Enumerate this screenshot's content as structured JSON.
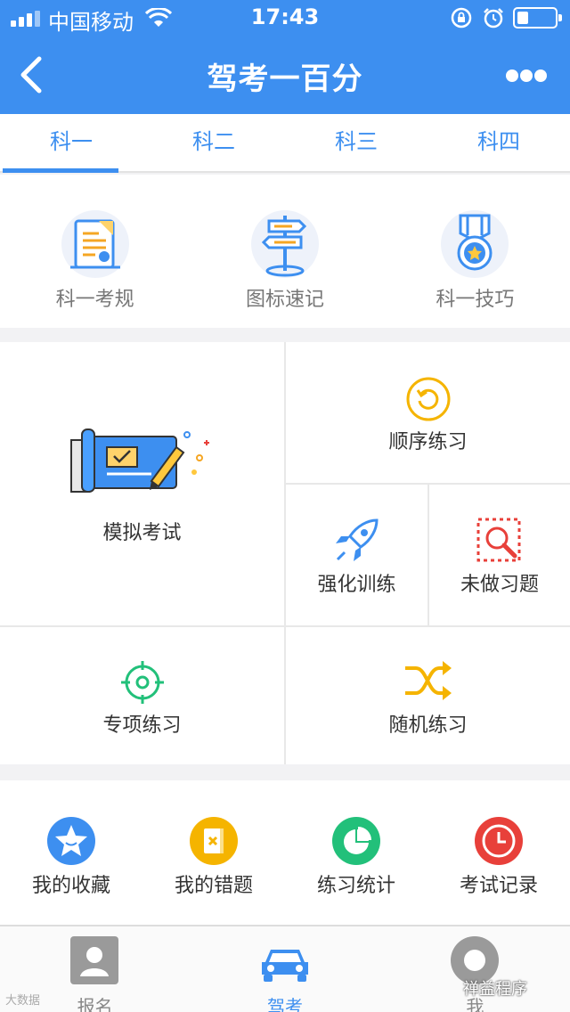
{
  "status_bar": {
    "carrier": "中国移动",
    "time": "17:43"
  },
  "nav": {
    "title": "驾考一百分"
  },
  "tabs": [
    {
      "label": "科一",
      "active": true
    },
    {
      "label": "科二",
      "active": false
    },
    {
      "label": "科三",
      "active": false
    },
    {
      "label": "科四",
      "active": false
    }
  ],
  "guide": [
    {
      "label": "科一考规",
      "icon": "document-icon"
    },
    {
      "label": "图标速记",
      "icon": "signpost-icon"
    },
    {
      "label": "科一技巧",
      "icon": "medal-icon"
    }
  ],
  "practice": {
    "mock_exam": "模拟考试",
    "sequential": "顺序练习",
    "intensive": "强化训练",
    "undone": "未做习题",
    "topic": "专项练习",
    "random": "随机练习"
  },
  "mine": [
    {
      "label": "我的收藏",
      "icon": "star-icon",
      "color": "#3d8ff0"
    },
    {
      "label": "我的错题",
      "icon": "wrong-book-icon",
      "color": "#f5b400"
    },
    {
      "label": "练习统计",
      "icon": "pie-chart-icon",
      "color": "#22c07a"
    },
    {
      "label": "考试记录",
      "icon": "clock-icon",
      "color": "#e8403a"
    }
  ],
  "tabbar": [
    {
      "label": "报名",
      "active": false
    },
    {
      "label": "驾考",
      "active": true
    },
    {
      "label": "我",
      "active": false
    }
  ],
  "watermark": "大数据",
  "brand": "禅益程序",
  "colors": {
    "primary": "#3d8ff0",
    "background": "#f2f2f4"
  }
}
